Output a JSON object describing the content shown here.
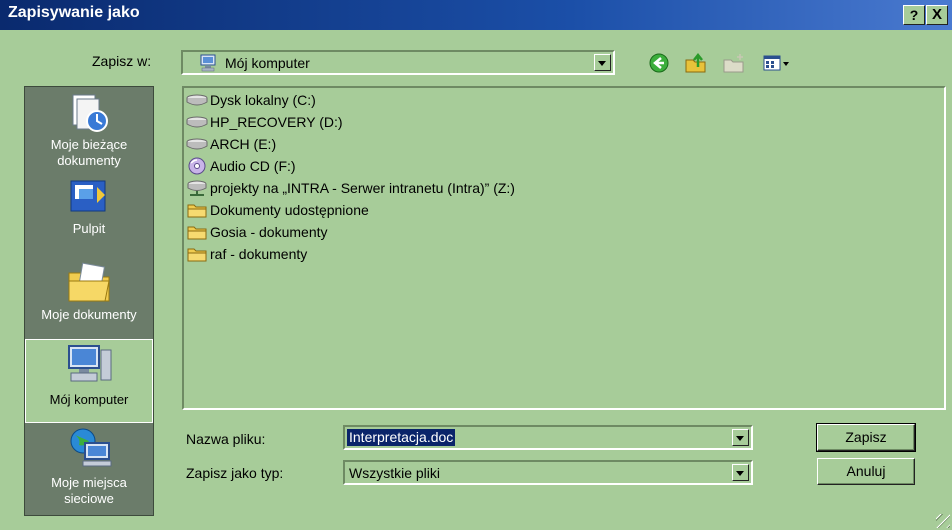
{
  "window": {
    "title": "Zapisywanie jako",
    "help_label": "?",
    "close_label": "X"
  },
  "toolbar": {
    "save_in_label": "Zapisz w:",
    "location": "Mój komputer",
    "icons": [
      "back-icon",
      "up-folder-icon",
      "new-folder-icon",
      "view-menu-icon"
    ]
  },
  "places": [
    {
      "label": "Moje bieżące dokumenty",
      "icon": "recent-documents-icon"
    },
    {
      "label": "Pulpit",
      "icon": "desktop-icon"
    },
    {
      "label": "Moje dokumenty",
      "icon": "my-documents-icon"
    },
    {
      "label": "Mój komputer",
      "icon": "my-computer-icon",
      "selected": true
    },
    {
      "label": "Moje miejsca sieciowe",
      "icon": "network-places-icon"
    }
  ],
  "files": [
    {
      "name": "Dysk lokalny (C:)",
      "icon": "hard-drive-icon"
    },
    {
      "name": "HP_RECOVERY (D:)",
      "icon": "hard-drive-icon"
    },
    {
      "name": "ARCH (E:)",
      "icon": "hard-drive-icon"
    },
    {
      "name": "Audio CD (F:)",
      "icon": "cd-drive-icon"
    },
    {
      "name": "projekty na „INTRA - Serwer intranetu (Intra)” (Z:)",
      "icon": "network-drive-icon"
    },
    {
      "name": "Dokumenty udostępnione",
      "icon": "folder-icon"
    },
    {
      "name": "Gosia - dokumenty",
      "icon": "folder-icon"
    },
    {
      "name": "raf - dokumenty",
      "icon": "folder-icon"
    }
  ],
  "form": {
    "filename_label": "Nazwa pliku:",
    "filename_value": "Interpretacja.doc",
    "filetype_label": "Zapisz jako typ:",
    "filetype_value": "Wszystkie pliki"
  },
  "buttons": {
    "save": "Zapisz",
    "cancel": "Anuluj"
  },
  "colors": {
    "dialog_bg": "#a7cc99",
    "places_bg": "#6b7c6a",
    "title_bar": "#0a2a6e",
    "selection": "#0a246a"
  }
}
